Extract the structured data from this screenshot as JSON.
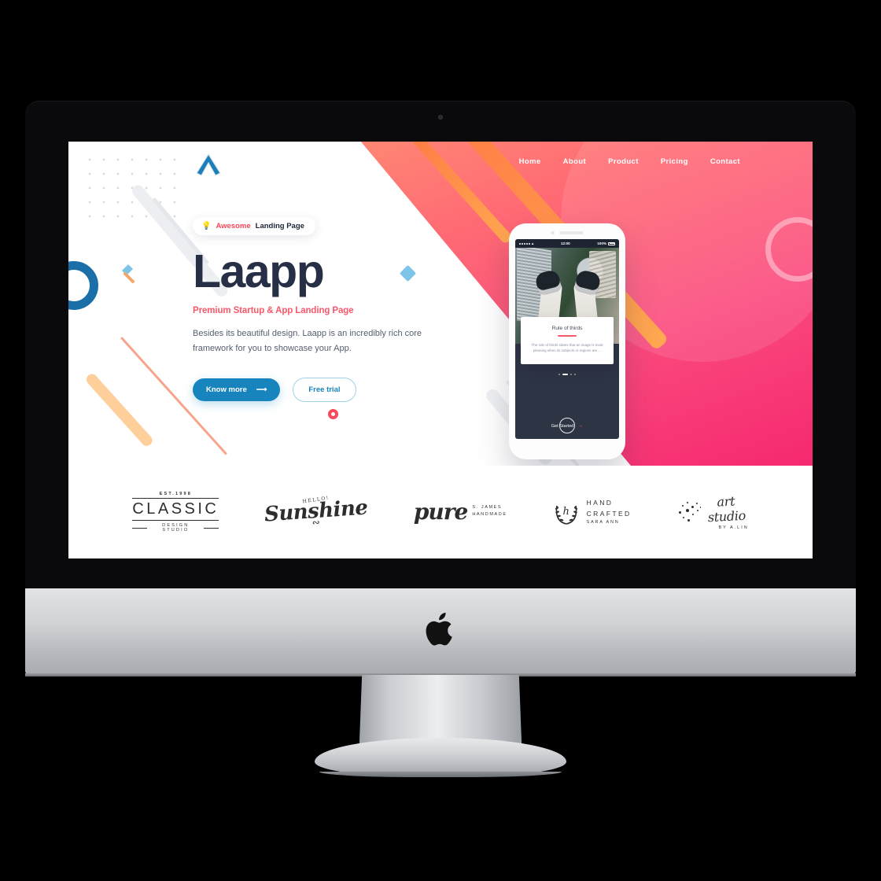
{
  "device": {
    "brand_icon": "apple-logo",
    "camera_icon": "webcam-dot"
  },
  "header": {
    "logo_icon": "laapp-chevron-logo",
    "nav": [
      {
        "label": "Home"
      },
      {
        "label": "About"
      },
      {
        "label": "Product"
      },
      {
        "label": "Pricing"
      },
      {
        "label": "Contact"
      }
    ]
  },
  "hero": {
    "badge": {
      "icon": "lightbulb-icon",
      "accent_text": "Awesome",
      "text": "Landing Page"
    },
    "title": "Laapp",
    "subtitle": "Premium Startup & App Landing Page",
    "paragraph": "Besides its beautiful design. Laapp is an incredibly rich core framework for you to showcase your App.",
    "primary_button": {
      "label": "Know more",
      "icon": "arrow-right-icon"
    },
    "secondary_button": {
      "label": "Free trial"
    }
  },
  "phone": {
    "status": {
      "carrier_dots": "signal-icon",
      "wifi": "wifi-icon",
      "time": "12:00",
      "battery_percent": "100%"
    },
    "card": {
      "title": "Rule of thirds",
      "text": "The rule of thirds states that an image is most pleasing when its subjects or regions are ..."
    },
    "cta": {
      "label": "Get Started",
      "icon": "arrow-right-icon"
    }
  },
  "logos": [
    {
      "name": "classic-design-studio",
      "est": "EST.1998",
      "main": "CLASSIC",
      "sub": "DESIGN STUDIO"
    },
    {
      "name": "hello-sunshine",
      "hello": "HELLO!",
      "word": "Sunshine"
    },
    {
      "name": "pure-s-james-handmade",
      "word": "pure",
      "line1": "S. JAMES",
      "line2": "HANDMADE"
    },
    {
      "name": "hand-crafted-sara-ann",
      "monogram": "h",
      "line1": "HAND",
      "line2": "CRAFTED",
      "line3": "SARA ANN"
    },
    {
      "name": "art-studio-by-a-lin",
      "word": "art studio",
      "by": "BY A.LIN"
    }
  ],
  "colors": {
    "pink_start": "#ff8c73",
    "pink_end": "#f5276f",
    "orange": "#ff7a45",
    "accent_red": "#f8485c",
    "blue": "#1784bd",
    "dark_text": "#262f45"
  }
}
